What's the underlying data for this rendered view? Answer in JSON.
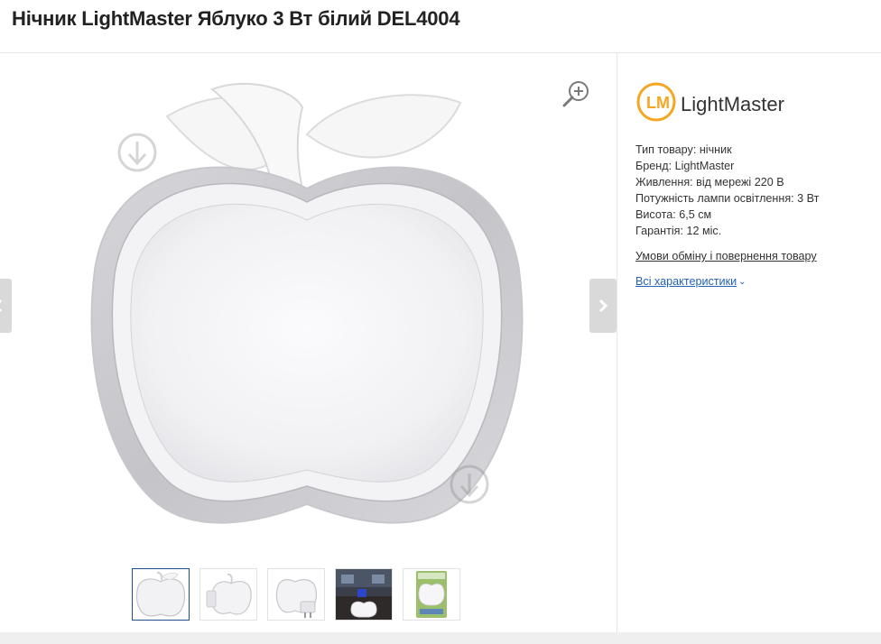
{
  "product": {
    "title": "Нічник LightMaster Яблуко 3 Вт білий DEL4004"
  },
  "brand": {
    "logo_text": "LightMaster",
    "logo_mark": "LM",
    "accent_color": "#f5a623",
    "text_color": "#333333"
  },
  "specs": [
    "Тип товару: нічник",
    "Бренд: LightMaster",
    "Живлення: від мережі 220 В",
    "Потужність лампи освітлення: 3 Вт",
    "Висота: 6,5 см",
    "Гарантія: 12 міс."
  ],
  "links": {
    "return_policy": "Умови обміну і повернення товару",
    "all_specs": "Всі характеристики",
    "all_specs_color": "#2563b8"
  },
  "gallery": {
    "icons": {
      "zoom": "zoom-in-icon",
      "prev": "chevron-left-icon",
      "next": "chevron-right-icon",
      "watermark": "download-arrow-icon"
    },
    "thumbnails": [
      {
        "name": "apple-front",
        "active": true
      },
      {
        "name": "apple-side",
        "active": false
      },
      {
        "name": "apple-plug",
        "active": false
      },
      {
        "name": "apple-room",
        "active": false
      },
      {
        "name": "apple-package",
        "active": false
      }
    ],
    "active_border_color": "#1f4e8c"
  }
}
